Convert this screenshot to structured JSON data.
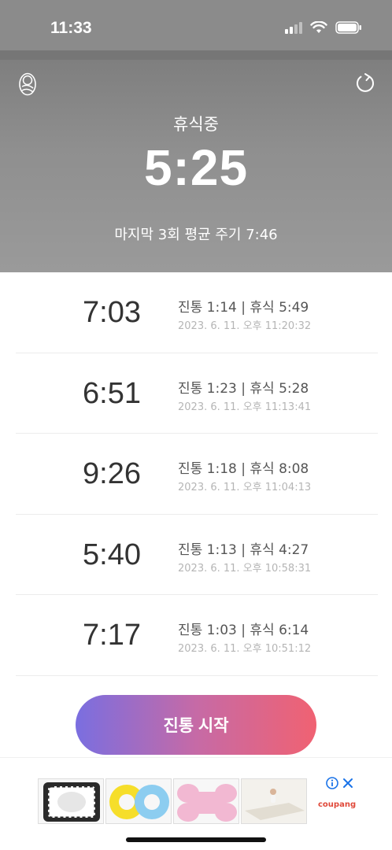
{
  "status_bar": {
    "time": "11:33"
  },
  "header": {
    "state_label": "휴식중",
    "timer": "5:25",
    "average_text": "마지막 3회 평균 주기 7:46"
  },
  "records": [
    {
      "cycle": "7:03",
      "summary": "진통 1:14 | 휴식 5:49",
      "timestamp": "2023. 6. 11. 오후 11:20:32"
    },
    {
      "cycle": "6:51",
      "summary": "진통 1:23 | 휴식 5:28",
      "timestamp": "2023. 6. 11. 오후 11:13:41"
    },
    {
      "cycle": "9:26",
      "summary": "진통 1:18 | 휴식 8:08",
      "timestamp": "2023. 6. 11. 오후 11:04:13"
    },
    {
      "cycle": "5:40",
      "summary": "진통 1:13 | 휴식 4:27",
      "timestamp": "2023. 6. 11. 오후 10:58:31"
    },
    {
      "cycle": "7:17",
      "summary": "진통 1:03 | 휴식 6:14",
      "timestamp": "2023. 6. 11. 오후 10:51:12"
    }
  ],
  "start_button": {
    "label": "진통 시작"
  },
  "ad": {
    "brand": "coupang"
  },
  "colors": {
    "header_gray": "#8f8f8f",
    "button_start": "#7a6ee0",
    "button_end": "#f06272",
    "ad_info_blue": "#1a73e8"
  },
  "icons": [
    "baby-icon",
    "refresh-icon",
    "wifi-icon",
    "battery-icon",
    "info-icon",
    "close-icon"
  ]
}
